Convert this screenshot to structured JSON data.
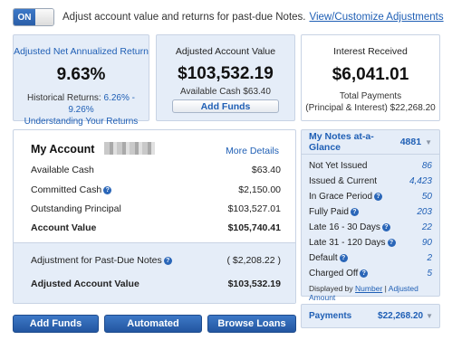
{
  "top": {
    "toggle_on": "ON",
    "message": "Adjust account value and returns for past-due Notes.",
    "link": "View/Customize Adjustments"
  },
  "return_box": {
    "label": "Adjusted Net Annualized Return",
    "value": "9.63%",
    "historical_label": "Historical Returns:",
    "historical_range": "6.26% - 9.26%",
    "understanding_link": "Understanding Your Returns"
  },
  "value_box": {
    "label": "Adjusted Account Value",
    "value": "$103,532.19",
    "available": "Available Cash $63.40",
    "add_funds": "Add Funds"
  },
  "interest_box": {
    "label": "Interest Received",
    "value": "$6,041.01",
    "total_line1": "Total Payments",
    "total_line2": "(Principal & Interest) $22,268.20"
  },
  "account": {
    "title": "My Account",
    "more_details": "More Details",
    "rows": [
      {
        "label": "Available Cash",
        "value": "$63.40"
      },
      {
        "label": "Committed Cash",
        "value": "$2,150.00"
      },
      {
        "label": "Outstanding Principal",
        "value": "$103,527.01"
      },
      {
        "label": "Account Value",
        "value": "$105,740.41"
      }
    ],
    "adjustment_label": "Adjustment for Past-Due Notes",
    "adjustment_value": "( $2,208.22 )",
    "adjusted_label": "Adjusted Account Value",
    "adjusted_value": "$103,532.19"
  },
  "notes": {
    "title": "My Notes at-a-Glance",
    "count": "4881",
    "rows": [
      {
        "label": "Not Yet Issued",
        "value": "86"
      },
      {
        "label": "Issued & Current",
        "value": "4,423"
      },
      {
        "label": "In Grace Period",
        "value": "50"
      },
      {
        "label": "Fully Paid",
        "value": "203"
      },
      {
        "label": "Late 16 - 30 Days",
        "value": "22"
      },
      {
        "label": "Late 31 - 120 Days",
        "value": "90"
      },
      {
        "label": "Default",
        "value": "2"
      },
      {
        "label": "Charged Off",
        "value": "5"
      }
    ],
    "displayed_by": "Displayed by",
    "number_link": "Number",
    "sep": "|",
    "amount_link": "Adjusted Amount"
  },
  "payments": {
    "label": "Payments",
    "value": "$22,268.20"
  },
  "buttons": {
    "add_funds": "Add Funds",
    "automated": "Automated Investing",
    "browse": "Browse Loans"
  },
  "icons": {
    "help": "help-icon",
    "caret": "caret-down-icon"
  }
}
